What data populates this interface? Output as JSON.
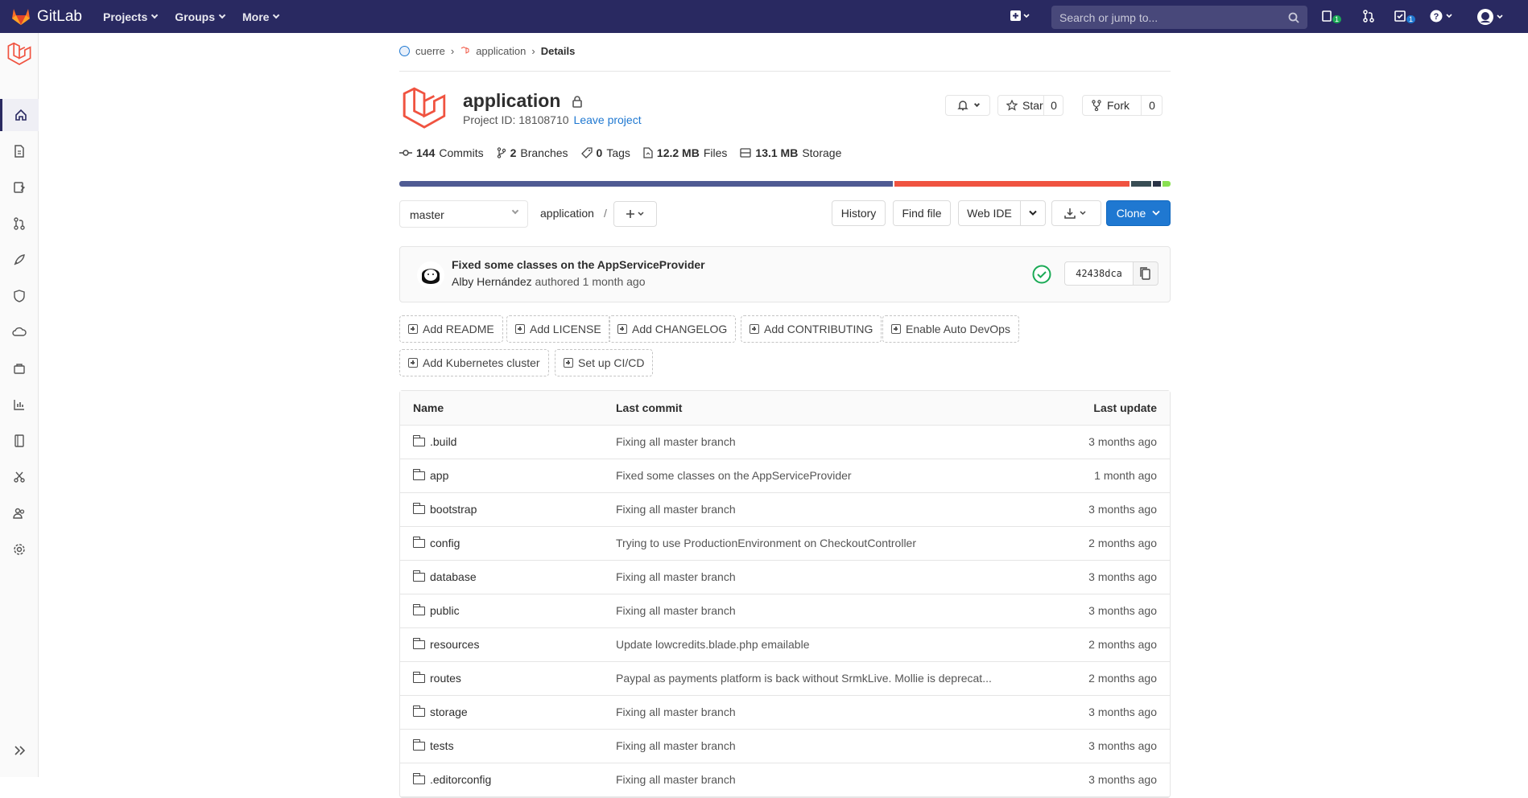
{
  "app": {
    "name": "GitLab"
  },
  "nav": {
    "projects": "Projects",
    "groups": "Groups",
    "more": "More",
    "search_placeholder": "Search or jump to...",
    "issues_count": "1",
    "todos_count": "1"
  },
  "breadcrumb": {
    "group": "cuerre",
    "project": "application",
    "current": "Details"
  },
  "project": {
    "name": "application",
    "id_label": "Project ID: 18108710",
    "leave": "Leave project",
    "star_label": "Star",
    "star_count": "0",
    "fork_label": "Fork",
    "fork_count": "0"
  },
  "stats": {
    "commits_num": "144",
    "commits_label": "Commits",
    "branches_num": "2",
    "branches_label": "Branches",
    "tags_num": "0",
    "tags_label": "Tags",
    "files_num": "12.2 MB",
    "files_label": "Files",
    "storage_num": "13.1 MB",
    "storage_label": "Storage"
  },
  "languages": [
    {
      "color": "#4f5b93",
      "pct": 64.5
    },
    {
      "color": "#f05340",
      "pct": 30.8
    },
    {
      "color": "#384d54",
      "pct": 2.6
    },
    {
      "color": "#293345",
      "pct": 1.0
    },
    {
      "color": "#89e051",
      "pct": 1.1
    }
  ],
  "toolbar": {
    "branch": "master",
    "path": "application",
    "path_sep": "/",
    "history": "History",
    "find_file": "Find file",
    "web_ide": "Web IDE",
    "clone": "Clone"
  },
  "commit": {
    "title": "Fixed some classes on the AppServiceProvider",
    "author": "Alby Hernández",
    "meta": "authored 1 month ago",
    "sha": "42438dca"
  },
  "quick_actions": [
    "Add README",
    "Add LICENSE",
    "Add CHANGELOG",
    "Add CONTRIBUTING",
    "Enable Auto DevOps",
    "Add Kubernetes cluster",
    "Set up CI/CD"
  ],
  "table": {
    "headers": {
      "name": "Name",
      "last_commit": "Last commit",
      "last_update": "Last update"
    },
    "rows": [
      {
        "name": ".build",
        "commit": "Fixing all master branch",
        "updated": "3 months ago"
      },
      {
        "name": "app",
        "commit": "Fixed some classes on the AppServiceProvider",
        "updated": "1 month ago"
      },
      {
        "name": "bootstrap",
        "commit": "Fixing all master branch",
        "updated": "3 months ago"
      },
      {
        "name": "config",
        "commit": "Trying to use ProductionEnvironment on CheckoutController",
        "updated": "2 months ago"
      },
      {
        "name": "database",
        "commit": "Fixing all master branch",
        "updated": "3 months ago"
      },
      {
        "name": "public",
        "commit": "Fixing all master branch",
        "updated": "3 months ago"
      },
      {
        "name": "resources",
        "commit": "Update lowcredits.blade.php emailable",
        "updated": "2 months ago"
      },
      {
        "name": "routes",
        "commit": "Paypal as payments platform is back without SrmkLive. Mollie is deprecat...",
        "updated": "2 months ago"
      },
      {
        "name": "storage",
        "commit": "Fixing all master branch",
        "updated": "3 months ago"
      },
      {
        "name": "tests",
        "commit": "Fixing all master branch",
        "updated": "3 months ago"
      },
      {
        "name": ".editorconfig",
        "commit": "Fixing all master branch",
        "updated": "3 months ago"
      }
    ]
  },
  "colors": {
    "nav_bg": "#292961",
    "accent": "#1f78d1",
    "success": "#1aaa55"
  }
}
